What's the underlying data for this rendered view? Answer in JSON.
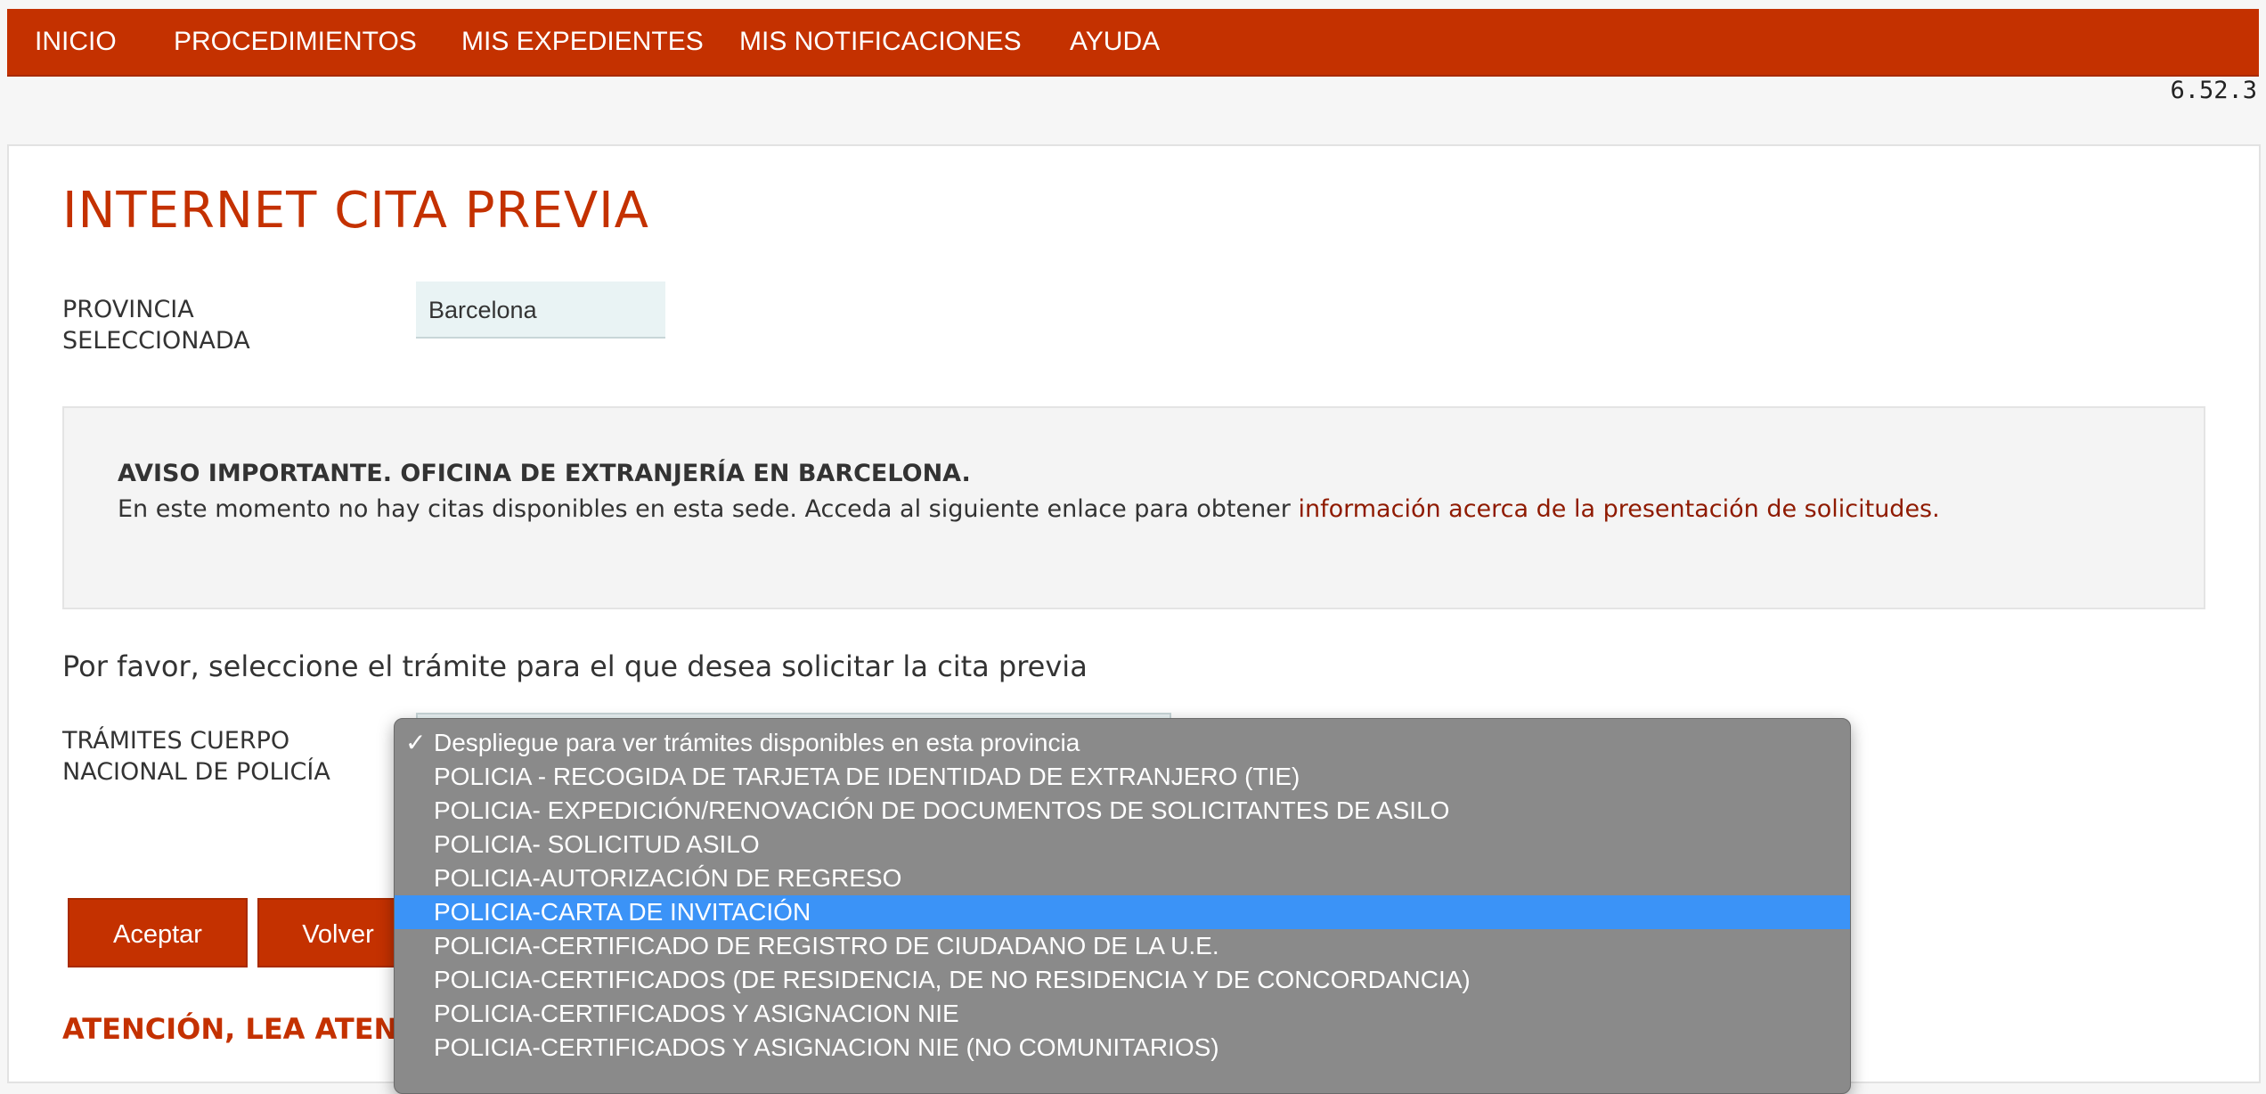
{
  "nav": {
    "items": [
      "INICIO",
      "PROCEDIMIENTOS",
      "MIS EXPEDIENTES",
      "MIS NOTIFICACIONES",
      "AYUDA"
    ],
    "version": "6.52.3"
  },
  "page": {
    "title": "INTERNET CITA PREVIA",
    "province_label_1": "PROVINCIA",
    "province_label_2": "SELECCIONADA",
    "province_value": "Barcelona"
  },
  "notice": {
    "title": "AVISO IMPORTANTE. OFICINA DE EXTRANJERÍA EN BARCELONA.",
    "text": "En este momento no hay citas disponibles en esta sede. Acceda al siguiente enlace para obtener ",
    "link": "información acerca de la presentación de solicitudes",
    "text_end": "."
  },
  "form": {
    "intro": "Por favor, seleccione el trámite para el que desea solicitar la cita previa",
    "tramites_label_1": "TRÁMITES CUERPO",
    "tramites_label_2": "NACIONAL DE POLICÍA",
    "accept_label": "Aceptar",
    "back_label": "Volver",
    "warning": "ATENCIÓN, LEA ATENT"
  },
  "dropdown": {
    "check_mark": "✓",
    "selected_index": 0,
    "highlighted_index": 5,
    "options": [
      "Despliegue para ver trámites disponibles en esta provincia",
      "POLICIA - RECOGIDA DE TARJETA DE IDENTIDAD DE EXTRANJERO (TIE)",
      "POLICIA- EXPEDICIÓN/RENOVACIÓN DE DOCUMENTOS DE SOLICITANTES DE ASILO",
      "POLICIA- SOLICITUD ASILO",
      "POLICIA-AUTORIZACIÓN DE REGRESO",
      "POLICIA-CARTA DE INVITACIÓN",
      "POLICIA-CERTIFICADO DE REGISTRO DE CIUDADANO DE LA U.E.",
      "POLICIA-CERTIFICADOS (DE RESIDENCIA, DE NO RESIDENCIA Y DE CONCORDANCIA)",
      "POLICIA-CERTIFICADOS Y ASIGNACION NIE",
      "POLICIA-CERTIFICADOS Y ASIGNACION NIE (NO COMUNITARIOS)"
    ]
  },
  "colors": {
    "brand": "#c43100",
    "link": "#8f1a00",
    "highlight": "#3b93f7"
  }
}
